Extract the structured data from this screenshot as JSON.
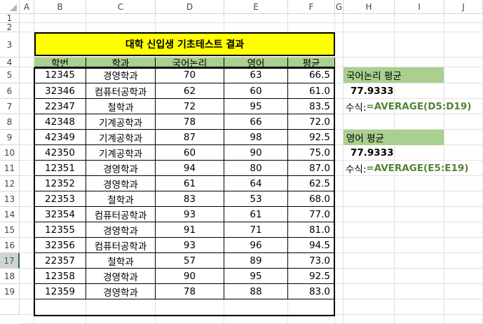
{
  "columns": [
    "A",
    "B",
    "C",
    "D",
    "E",
    "F",
    "G",
    "H",
    "I",
    "J"
  ],
  "rows": [
    "1",
    "2",
    "3",
    "4",
    "5",
    "6",
    "7",
    "8",
    "9",
    "10",
    "11",
    "12",
    "13",
    "14",
    "15",
    "16",
    "17",
    "18",
    "19"
  ],
  "title": "대학 신입생 기초테스트 결과",
  "table": {
    "headers": [
      "학번",
      "학과",
      "국어논리",
      "영어",
      "평균"
    ],
    "rows": [
      [
        "12345",
        "경영학과",
        "70",
        "63",
        "66.5"
      ],
      [
        "32346",
        "컴퓨터공학과",
        "62",
        "60",
        "61.0"
      ],
      [
        "22347",
        "철학과",
        "72",
        "95",
        "83.5"
      ],
      [
        "42348",
        "기계공학과",
        "78",
        "66",
        "72.0"
      ],
      [
        "42349",
        "기계공학과",
        "87",
        "98",
        "92.5"
      ],
      [
        "42350",
        "기계공학과",
        "60",
        "90",
        "75.0"
      ],
      [
        "12351",
        "경영학과",
        "94",
        "80",
        "87.0"
      ],
      [
        "12352",
        "경영학과",
        "61",
        "64",
        "62.5"
      ],
      [
        "22353",
        "철학과",
        "83",
        "53",
        "68.0"
      ],
      [
        "32354",
        "컴퓨터공학과",
        "93",
        "61",
        "77.0"
      ],
      [
        "12355",
        "경영학과",
        "91",
        "71",
        "81.0"
      ],
      [
        "32356",
        "컴퓨터공학과",
        "93",
        "96",
        "94.5"
      ],
      [
        "22357",
        "철학과",
        "57",
        "89",
        "73.0"
      ],
      [
        "12358",
        "경영학과",
        "90",
        "95",
        "92.5"
      ],
      [
        "12359",
        "경영학과",
        "78",
        "88",
        "83.0"
      ]
    ]
  },
  "side": {
    "korean_label": "국어논리 평균",
    "korean_value": "77.9333",
    "korean_formula_prefix": "수식: ",
    "korean_formula": "=AVERAGE(D5:D19)",
    "english_label": "영어 평균",
    "english_value": "77.9333",
    "english_formula_prefix": "수식: ",
    "english_formula": "=AVERAGE(E5:E19)"
  },
  "active_row": "17",
  "colors": {
    "header_green": "#a9d08e",
    "title_yellow": "#ffff00",
    "formula_green": "#548235",
    "excel_green": "#217346"
  }
}
